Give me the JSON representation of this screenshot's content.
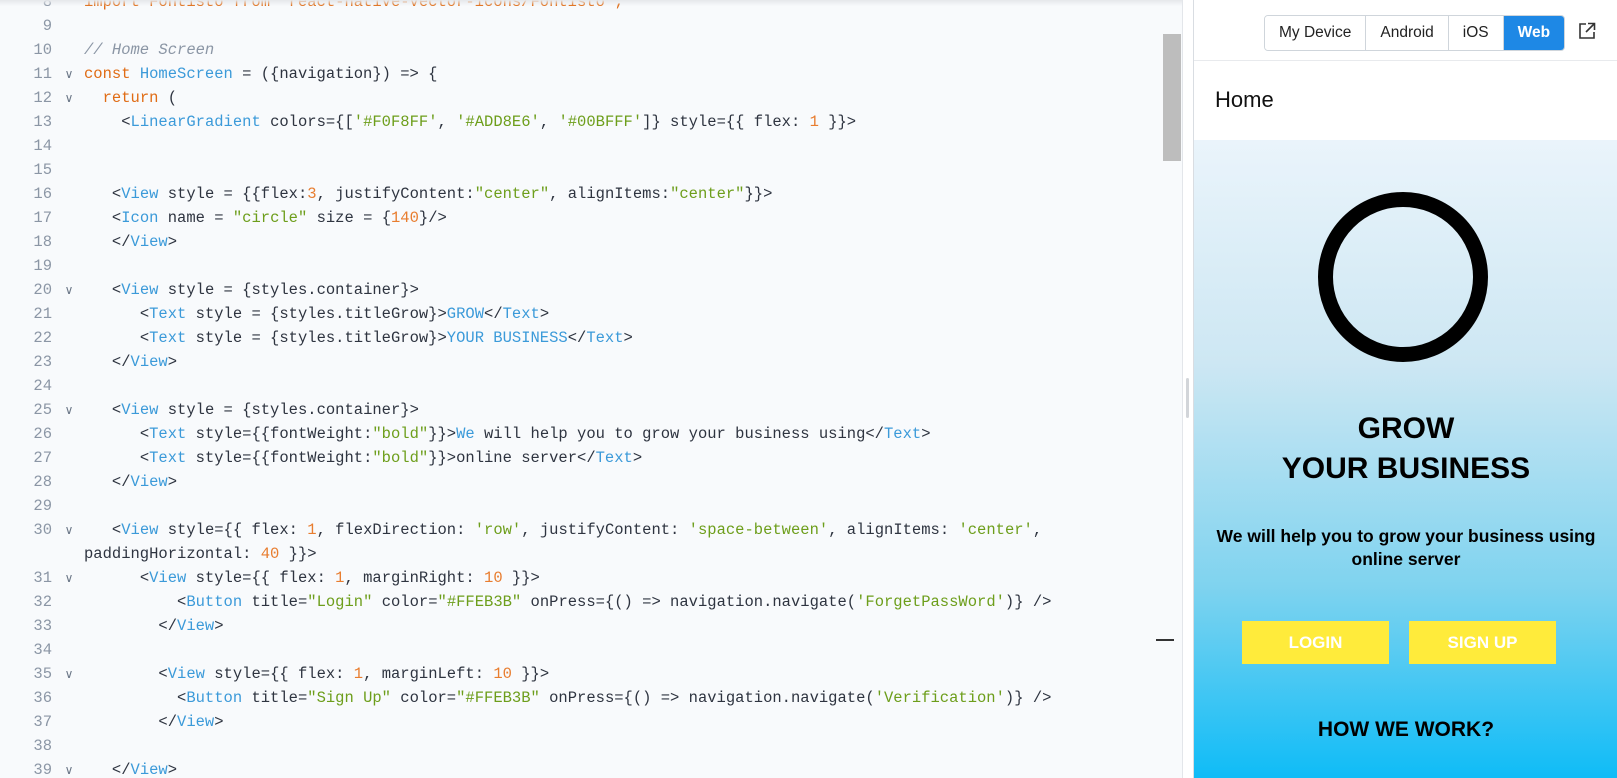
{
  "editor": {
    "lines": [
      {
        "n": "8",
        "fold": false,
        "tokens": [
          [
            "kw",
            "import Fontisto from 'react-native-vector-icons/Fontisto';"
          ]
        ]
      },
      {
        "n": "9",
        "fold": false,
        "tokens": []
      },
      {
        "n": "10",
        "fold": false,
        "tokens": [
          [
            "cm",
            "// Home Screen"
          ]
        ]
      },
      {
        "n": "11",
        "fold": true,
        "tokens": [
          [
            "kw",
            "const "
          ],
          [
            "tag",
            "HomeScreen"
          ],
          [
            "txt",
            " = ({navigation}) => {"
          ]
        ]
      },
      {
        "n": "12",
        "fold": true,
        "tokens": [
          [
            "txt",
            "  "
          ],
          [
            "kw",
            "return"
          ],
          [
            "txt",
            " ("
          ]
        ]
      },
      {
        "n": "13",
        "fold": false,
        "tokens": [
          [
            "txt",
            "    <"
          ],
          [
            "tag",
            "LinearGradient"
          ],
          [
            "txt",
            " colors={["
          ],
          [
            "str",
            "'#F0F8FF'"
          ],
          [
            "txt",
            ", "
          ],
          [
            "str",
            "'#ADD8E6'"
          ],
          [
            "txt",
            ", "
          ],
          [
            "str",
            "'#00BFFF'"
          ],
          [
            "txt",
            "]} style={{ flex: "
          ],
          [
            "num",
            "1"
          ],
          [
            "txt",
            " }}>"
          ]
        ]
      },
      {
        "n": "14",
        "fold": false,
        "tokens": []
      },
      {
        "n": "15",
        "fold": false,
        "tokens": []
      },
      {
        "n": "16",
        "fold": false,
        "tokens": [
          [
            "txt",
            "   <"
          ],
          [
            "tag",
            "View"
          ],
          [
            "txt",
            " style = {{flex:"
          ],
          [
            "num",
            "3"
          ],
          [
            "txt",
            ", justifyContent:"
          ],
          [
            "str",
            "\"center\""
          ],
          [
            "txt",
            ", alignItems:"
          ],
          [
            "str",
            "\"center\""
          ],
          [
            "txt",
            "}}>"
          ]
        ]
      },
      {
        "n": "17",
        "fold": false,
        "tokens": [
          [
            "txt",
            "   <"
          ],
          [
            "tag",
            "Icon"
          ],
          [
            "txt",
            " name = "
          ],
          [
            "str",
            "\"circle\""
          ],
          [
            "txt",
            " size = {"
          ],
          [
            "num",
            "140"
          ],
          [
            "txt",
            "}/>"
          ]
        ]
      },
      {
        "n": "18",
        "fold": false,
        "tokens": [
          [
            "txt",
            "   </"
          ],
          [
            "tag",
            "View"
          ],
          [
            "txt",
            ">"
          ]
        ]
      },
      {
        "n": "19",
        "fold": false,
        "tokens": []
      },
      {
        "n": "20",
        "fold": true,
        "tokens": [
          [
            "txt",
            "   <"
          ],
          [
            "tag",
            "View"
          ],
          [
            "txt",
            " style = {styles.container}>"
          ]
        ]
      },
      {
        "n": "21",
        "fold": false,
        "tokens": [
          [
            "txt",
            "      <"
          ],
          [
            "tag",
            "Text"
          ],
          [
            "txt",
            " style = {styles.titleGrow}>"
          ],
          [
            "tag",
            "GROW"
          ],
          [
            "txt",
            "</"
          ],
          [
            "tag",
            "Text"
          ],
          [
            "txt",
            ">"
          ]
        ]
      },
      {
        "n": "22",
        "fold": false,
        "tokens": [
          [
            "txt",
            "      <"
          ],
          [
            "tag",
            "Text"
          ],
          [
            "txt",
            " style = {styles.titleGrow}>"
          ],
          [
            "tag",
            "YOUR BUSINESS"
          ],
          [
            "txt",
            "</"
          ],
          [
            "tag",
            "Text"
          ],
          [
            "txt",
            ">"
          ]
        ]
      },
      {
        "n": "23",
        "fold": false,
        "tokens": [
          [
            "txt",
            "   </"
          ],
          [
            "tag",
            "View"
          ],
          [
            "txt",
            ">"
          ]
        ]
      },
      {
        "n": "24",
        "fold": false,
        "tokens": []
      },
      {
        "n": "25",
        "fold": true,
        "tokens": [
          [
            "txt",
            "   <"
          ],
          [
            "tag",
            "View"
          ],
          [
            "txt",
            " style = {styles.container}>"
          ]
        ]
      },
      {
        "n": "26",
        "fold": false,
        "tokens": [
          [
            "txt",
            "      <"
          ],
          [
            "tag",
            "Text"
          ],
          [
            "txt",
            " style={{fontWeight:"
          ],
          [
            "str",
            "\"bold\""
          ],
          [
            "txt",
            "}}>"
          ],
          [
            "tag",
            "We"
          ],
          [
            "txt",
            " will help you to grow your business using</"
          ],
          [
            "tag",
            "Text"
          ],
          [
            "txt",
            ">"
          ]
        ]
      },
      {
        "n": "27",
        "fold": false,
        "tokens": [
          [
            "txt",
            "      <"
          ],
          [
            "tag",
            "Text"
          ],
          [
            "txt",
            " style={{fontWeight:"
          ],
          [
            "str",
            "\"bold\""
          ],
          [
            "txt",
            "}}>online server</"
          ],
          [
            "tag",
            "Text"
          ],
          [
            "txt",
            ">"
          ]
        ]
      },
      {
        "n": "28",
        "fold": false,
        "tokens": [
          [
            "txt",
            "   </"
          ],
          [
            "tag",
            "View"
          ],
          [
            "txt",
            ">"
          ]
        ]
      },
      {
        "n": "29",
        "fold": false,
        "tokens": []
      },
      {
        "n": "30",
        "fold": true,
        "wrap": true,
        "tokens": [
          [
            "txt",
            "   <"
          ],
          [
            "tag",
            "View"
          ],
          [
            "txt",
            " style={{ flex: "
          ],
          [
            "num",
            "1"
          ],
          [
            "txt",
            ", flexDirection: "
          ],
          [
            "str",
            "'row'"
          ],
          [
            "txt",
            ", justifyContent: "
          ],
          [
            "str",
            "'space-between'"
          ],
          [
            "txt",
            ", alignItems: "
          ],
          [
            "str",
            "'center'"
          ],
          [
            "txt",
            ",\npaddingHorizontal: "
          ],
          [
            "num",
            "40"
          ],
          [
            "txt",
            " }}>"
          ]
        ]
      },
      {
        "n": "31",
        "fold": true,
        "tokens": [
          [
            "txt",
            "      <"
          ],
          [
            "tag",
            "View"
          ],
          [
            "txt",
            " style={{ flex: "
          ],
          [
            "num",
            "1"
          ],
          [
            "txt",
            ", marginRight: "
          ],
          [
            "num",
            "10"
          ],
          [
            "txt",
            " }}>"
          ]
        ]
      },
      {
        "n": "32",
        "fold": false,
        "tokens": [
          [
            "txt",
            "          <"
          ],
          [
            "tag",
            "Button"
          ],
          [
            "txt",
            " title="
          ],
          [
            "str",
            "\"Login\""
          ],
          [
            "txt",
            " color="
          ],
          [
            "str",
            "\"#FFEB3B\""
          ],
          [
            "txt",
            " onPress={() => navigation.navigate("
          ],
          [
            "str",
            "'ForgetPassWord'"
          ],
          [
            "txt",
            ")} />"
          ]
        ]
      },
      {
        "n": "33",
        "fold": false,
        "tokens": [
          [
            "txt",
            "        </"
          ],
          [
            "tag",
            "View"
          ],
          [
            "txt",
            ">"
          ]
        ]
      },
      {
        "n": "34",
        "fold": false,
        "tokens": []
      },
      {
        "n": "35",
        "fold": true,
        "tokens": [
          [
            "txt",
            "        <"
          ],
          [
            "tag",
            "View"
          ],
          [
            "txt",
            " style={{ flex: "
          ],
          [
            "num",
            "1"
          ],
          [
            "txt",
            ", marginLeft: "
          ],
          [
            "num",
            "10"
          ],
          [
            "txt",
            " }}>"
          ]
        ]
      },
      {
        "n": "36",
        "fold": false,
        "tokens": [
          [
            "txt",
            "          <"
          ],
          [
            "tag",
            "Button"
          ],
          [
            "txt",
            " title="
          ],
          [
            "str",
            "\"Sign Up\""
          ],
          [
            "txt",
            " color="
          ],
          [
            "str",
            "\"#FFEB3B\""
          ],
          [
            "txt",
            " onPress={() => navigation.navigate("
          ],
          [
            "str",
            "'Verification'"
          ],
          [
            "txt",
            ")} />"
          ]
        ]
      },
      {
        "n": "37",
        "fold": false,
        "tokens": [
          [
            "txt",
            "        </"
          ],
          [
            "tag",
            "View"
          ],
          [
            "txt",
            ">"
          ]
        ]
      },
      {
        "n": "38",
        "fold": false,
        "tokens": []
      },
      {
        "n": "39",
        "fold": true,
        "tokens": [
          [
            "txt",
            "   </"
          ],
          [
            "tag",
            "View"
          ],
          [
            "txt",
            ">"
          ]
        ]
      }
    ]
  },
  "preview": {
    "device_tabs": [
      "My Device",
      "Android",
      "iOS",
      "Web"
    ],
    "active_tab": "Web",
    "header_title": "Home",
    "title_line1": "GROW",
    "title_line2": "YOUR BUSINESS",
    "tagline": "We will help you to grow your business using online server",
    "login_label": "LOGIN",
    "signup_label": "SIGN UP",
    "how_label": "HOW WE WORK?",
    "colors": {
      "accent": "#1e88e5",
      "button": "#FFEB3B",
      "gradient": [
        "#F0F8FF",
        "#ADD8E6",
        "#00BFFF"
      ]
    },
    "icons": [
      "circle-icon",
      "open-external-icon"
    ]
  }
}
